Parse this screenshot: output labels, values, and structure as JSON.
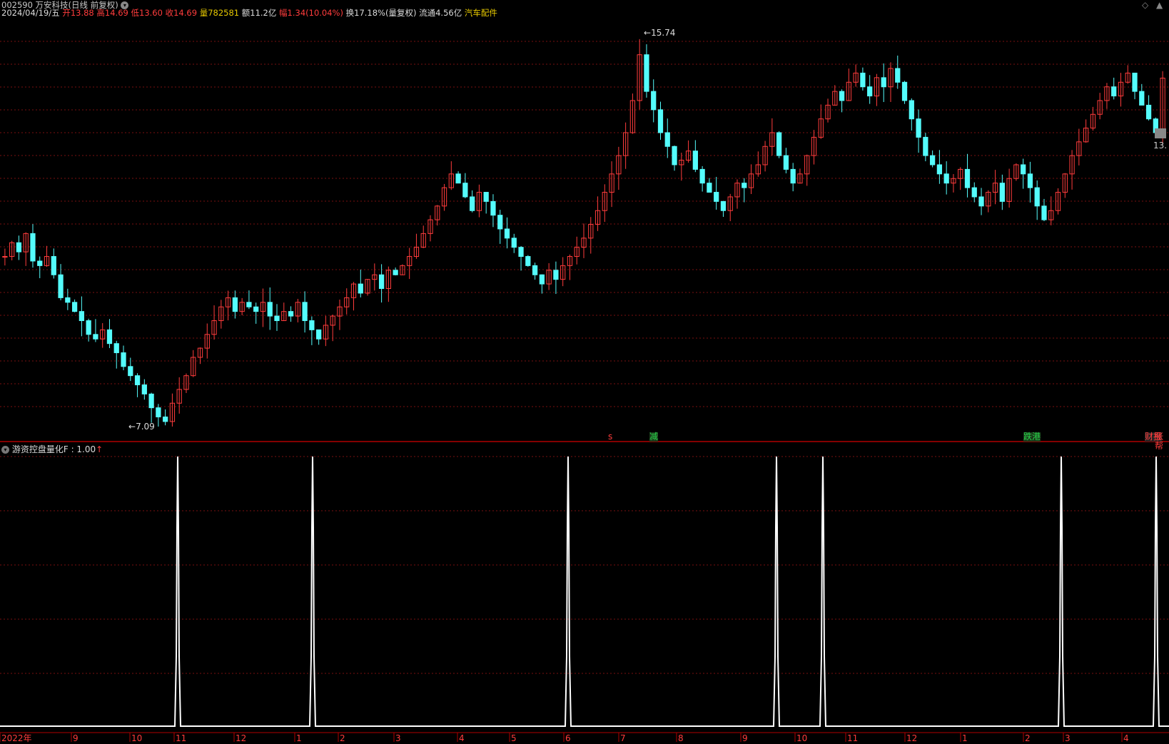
{
  "header": {
    "code_name": "002590 万安科技(日线 前复权)",
    "chevron_icon": "chevron-down-icon",
    "date": "2024/04/19/五",
    "open_label": "开",
    "open": "13.88",
    "high_label": "高",
    "high": "14.69",
    "low_label": "低",
    "low": "13.60",
    "close_label": "收",
    "close": "14.69",
    "vol_label": "量",
    "vol": "782581",
    "amount": "额11.2亿",
    "change_label": "幅",
    "change": "1.34(10.04%)",
    "turnover": "换17.18%(量复权)",
    "float": "流通4.56亿",
    "sector": "汽车配件"
  },
  "corner_icons": {
    "diamond": "◇",
    "caret": "▲"
  },
  "price_labels": {
    "high": "15.74",
    "low": "7.09",
    "right": "13."
  },
  "signals": {
    "s1": "s",
    "s2": "减",
    "s3": "跌港",
    "s4": "财报",
    "s5": "张帮"
  },
  "indicator": {
    "name": "游资控盘量化F",
    "value": ": 1.00",
    "arrow": "↑"
  },
  "xaxis": [
    "2022年",
    "9",
    "10",
    "11",
    "12",
    "1",
    "2",
    "3",
    "4",
    "5",
    "6",
    "7",
    "8",
    "9",
    "10",
    "11",
    "12",
    "1",
    "2",
    "3",
    "4"
  ],
  "colors": {
    "up": "#ff3c3c",
    "down": "#54fcfc",
    "grid": "#7a1010",
    "bg": "#000000",
    "line": "#ffffff"
  },
  "chart_data": {
    "type": "candlestick",
    "price_range": [
      7.09,
      15.74
    ],
    "close_series": [
      10.8,
      11.1,
      10.9,
      11.3,
      10.7,
      10.6,
      10.8,
      10.4,
      9.9,
      9.8,
      9.6,
      9.4,
      9.1,
      9.0,
      9.2,
      8.9,
      8.7,
      8.4,
      8.2,
      8.0,
      7.8,
      7.5,
      7.3,
      7.2,
      7.6,
      7.9,
      8.2,
      8.6,
      8.8,
      9.1,
      9.4,
      9.7,
      9.9,
      9.6,
      9.8,
      9.7,
      9.6,
      9.8,
      9.5,
      9.4,
      9.6,
      9.5,
      9.8,
      9.4,
      9.2,
      9.0,
      9.3,
      9.5,
      9.7,
      9.9,
      10.2,
      10.0,
      10.3,
      10.4,
      10.1,
      10.5,
      10.4,
      10.6,
      10.8,
      11.0,
      11.3,
      11.6,
      11.9,
      12.3,
      12.6,
      12.4,
      12.1,
      11.8,
      12.2,
      12.0,
      11.7,
      11.4,
      11.2,
      11.0,
      10.8,
      10.6,
      10.4,
      10.2,
      10.5,
      10.3,
      10.6,
      10.8,
      11.0,
      11.2,
      11.5,
      11.8,
      12.2,
      12.6,
      13.0,
      13.5,
      14.2,
      15.2,
      14.4,
      14.0,
      13.5,
      13.2,
      12.8,
      12.9,
      13.1,
      12.7,
      12.4,
      12.2,
      12.0,
      11.8,
      12.1,
      12.4,
      12.3,
      12.6,
      12.8,
      13.2,
      13.5,
      13.0,
      12.7,
      12.4,
      12.6,
      13.0,
      13.4,
      13.8,
      14.1,
      14.4,
      14.2,
      14.6,
      14.8,
      14.5,
      14.3,
      14.7,
      14.5,
      14.9,
      14.6,
      14.2,
      13.8,
      13.4,
      13.0,
      12.8,
      12.6,
      12.4,
      12.5,
      12.7,
      12.3,
      12.1,
      11.9,
      12.2,
      12.4,
      12.0,
      12.5,
      12.8,
      12.6,
      12.3,
      11.9,
      11.6,
      11.8,
      12.2,
      12.6,
      13.0,
      13.3,
      13.6,
      13.9,
      14.2,
      14.5,
      14.3,
      14.6,
      14.8,
      14.4,
      14.1,
      13.8,
      13.5,
      14.69
    ],
    "indicator_spikes_month_positions": [
      "11",
      "1",
      "6",
      "9",
      "10",
      "3",
      "4"
    ],
    "indicator_range": [
      0,
      1
    ]
  }
}
